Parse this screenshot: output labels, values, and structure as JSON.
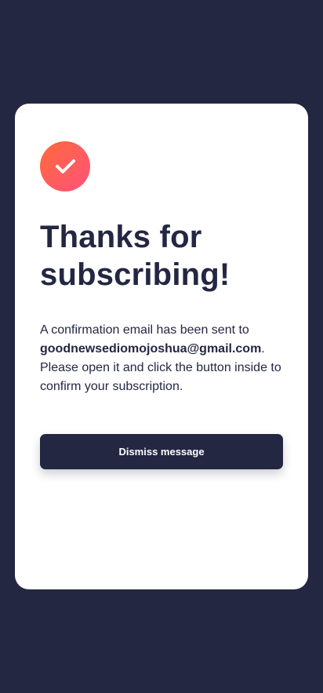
{
  "colors": {
    "background": "#242742",
    "card": "#ffffff",
    "text": "#242742",
    "accent_start": "#ff6a3a",
    "accent_end": "#ff527b"
  },
  "status_icon": "checkmark-icon",
  "heading": "Thanks for subscribing!",
  "message": {
    "prefix": "A confirmation email has been sent to ",
    "email": "goodnewsediomojoshua@gmail.com",
    "suffix": ". Please open it and click the button inside to confirm your subscription."
  },
  "actions": {
    "dismiss_label": "Dismiss message"
  }
}
